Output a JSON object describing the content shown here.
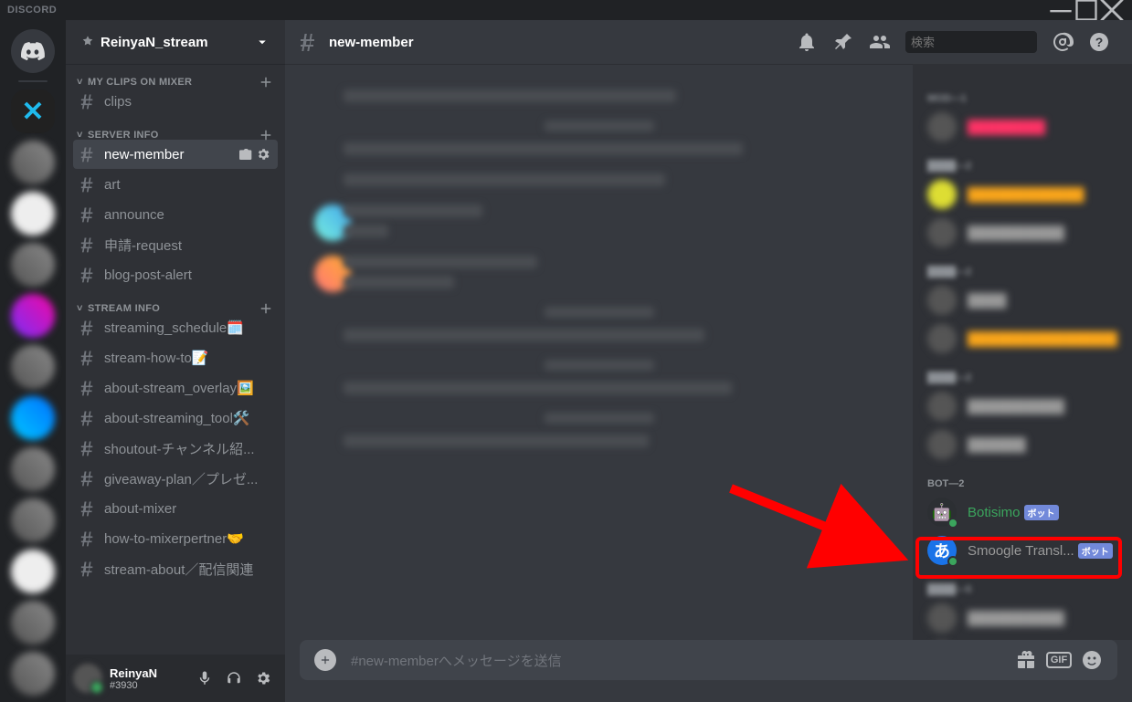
{
  "titlebar": {
    "app": "DISCORD"
  },
  "server": {
    "name": "ReinyaN_stream"
  },
  "categories": [
    {
      "name": "MY CLIPS ON MIXER",
      "channels": [
        {
          "label": "clips"
        }
      ]
    },
    {
      "name": "SERVER INFO",
      "channels": [
        {
          "label": "new-member",
          "active": true
        },
        {
          "label": "art"
        },
        {
          "label": "announce"
        },
        {
          "label": "申請-request"
        },
        {
          "label": "blog-post-alert"
        }
      ]
    },
    {
      "name": "STREAM INFO",
      "channels": [
        {
          "label": "streaming_schedule",
          "suffix": "🗓️"
        },
        {
          "label": "stream-how-to",
          "suffix": "📝"
        },
        {
          "label": "about-stream_overlay",
          "suffix": "🖼️"
        },
        {
          "label": "about-streaming_tool",
          "suffix": "🛠️"
        },
        {
          "label": "shoutout-チャンネル紹..."
        },
        {
          "label": "giveaway-plan／プレゼ..."
        },
        {
          "label": "about-mixer"
        },
        {
          "label": "how-to-mixerpertner",
          "suffix": "🤝"
        },
        {
          "label": "stream-about／配信関連"
        }
      ]
    }
  ],
  "user": {
    "name": "ReinyaN",
    "tag": "#3930"
  },
  "header": {
    "channel": "new-member",
    "search_placeholder": "検索"
  },
  "input": {
    "placeholder": "#new-memberへメッセージを送信"
  },
  "members": {
    "bot_header": "BOT—2",
    "bots": [
      {
        "name": "Botisimo",
        "badge": "ボット",
        "color": "#3ba55d"
      },
      {
        "name": "Smoogle Transl...",
        "badge": "ボット",
        "color": "#dcddde"
      }
    ]
  }
}
